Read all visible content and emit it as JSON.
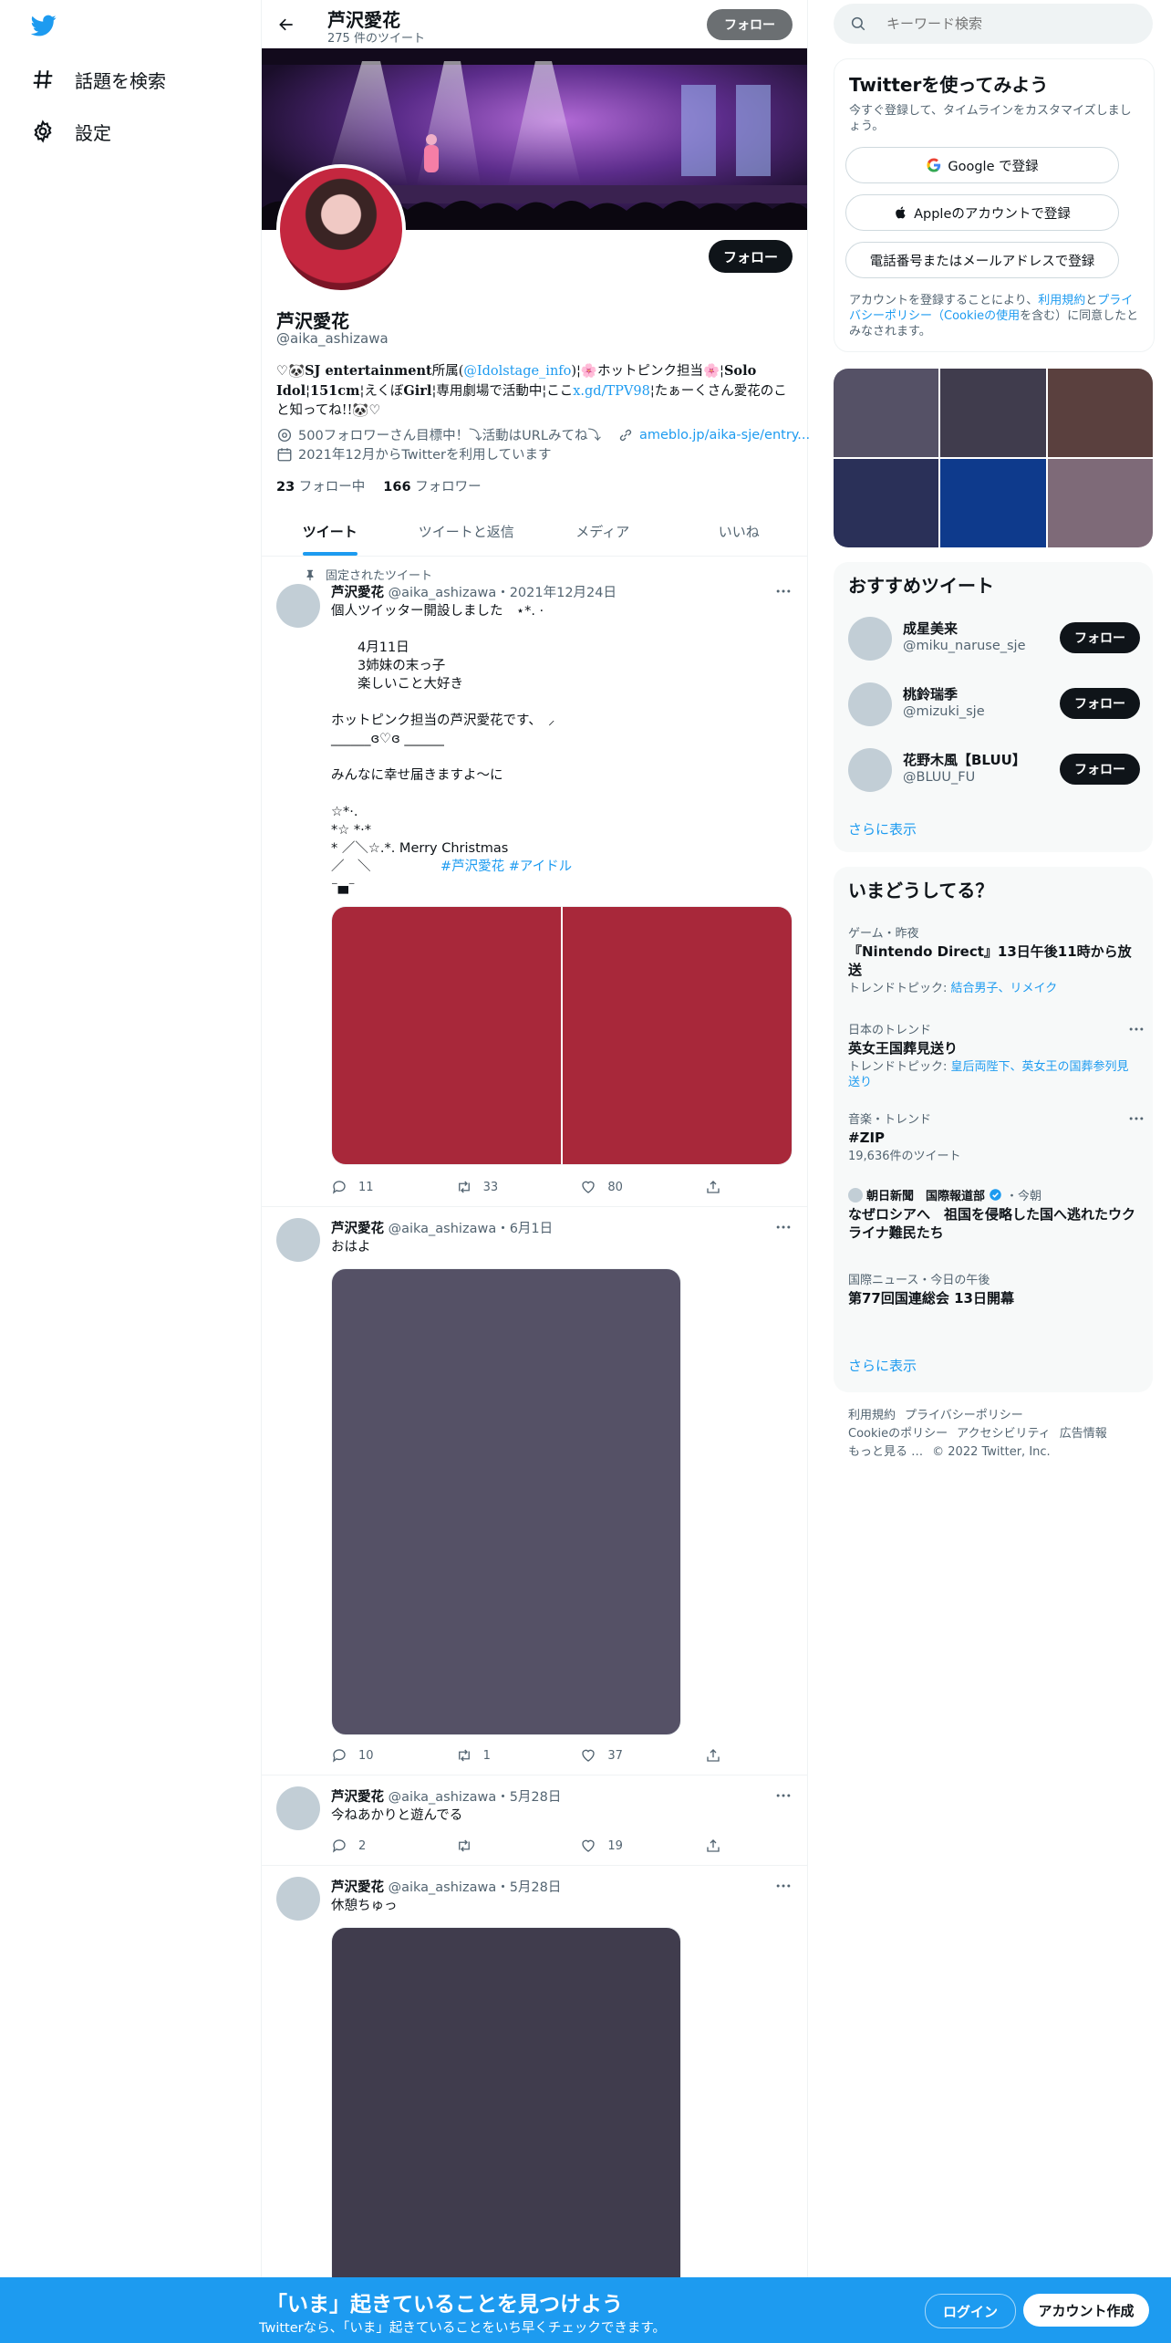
{
  "nav": {
    "explore": "話題を検索",
    "settings": "設定"
  },
  "header": {
    "name": "芦沢愛花",
    "tweet_count": "275 件のツイート",
    "follow": "フォロー"
  },
  "profile": {
    "name": "芦沢愛花",
    "handle": "@aika_ashizawa",
    "follow": "フォロー",
    "bio_parts": {
      "p1": "♡🐼",
      "p2": "SJ entertainment",
      "p3": "所属(",
      "mention": "@Idolstage_info",
      "p4": ")¦🌸ホットピンク担当🌸¦",
      "p5": "Solo Idol",
      "p6": "¦",
      "p7": "151cm",
      "p8": "¦えくぼ",
      "p9": "Girl",
      "p10": "¦専用劇場で活動中¦ここ",
      "link": "x.gd/TPV98",
      "p11": "¦たぁーくさん愛花のこと知ってね!!🐼♡"
    },
    "location": "500フォロワーさん目標中！⤵︎活動はURLみてね⤵︎",
    "url": "ameblo.jp/aika-sje/entry...",
    "joined": "2021年12月からTwitterを利用しています",
    "following_count": "23",
    "following_label": "フォロー中",
    "followers_count": "166",
    "followers_label": "フォロワー"
  },
  "tabs": [
    "ツイート",
    "ツイートと返信",
    "メディア",
    "いいね"
  ],
  "tweets": [
    {
      "pinned_label": "固定されたツイート",
      "name": "芦沢愛花",
      "handle": "@aika_ashizawa",
      "date": "・2021年12月24日",
      "text": "個人ツイッター開設しました　⋆*. ·\n\n　　4月11日\n　　3姉妹の末っ子\n　　楽しいこと大好き\n\nホットピンク担当の芦沢愛花です、　⸝\n______ɞ♡ɞ ______\n\nみんなに幸せ届きますよ〜に\n\n☆*·.\n*☆ *·*\n* ／＼☆.*. Merry Christmas\n／　＼",
      "tags": "#芦沢愛花 #アイドル",
      "replies": "11",
      "retweets": "33",
      "likes": "80"
    },
    {
      "name": "芦沢愛花",
      "handle": "@aika_ashizawa",
      "date": "・6月1日",
      "text": "おはよ",
      "replies": "10",
      "retweets": "1",
      "likes": "37"
    },
    {
      "name": "芦沢愛花",
      "handle": "@aika_ashizawa",
      "date": "・5月28日",
      "text": "今ねあかりと遊んでる",
      "replies": "2",
      "retweets": "",
      "likes": "19"
    },
    {
      "name": "芦沢愛花",
      "handle": "@aika_ashizawa",
      "date": "・5月28日",
      "text": "休憩ちゅっ"
    }
  ],
  "search": {
    "placeholder": "キーワード検索"
  },
  "signup": {
    "title": "Twitterを使ってみよう",
    "subtitle": "今すぐ登録して、タイムラインをカスタマイズしましょう。",
    "google": "Google で登録",
    "apple": "Appleのアカウントで登録",
    "phone": "電話番号またはメールアドレスで登録",
    "legal_1": "アカウントを登録することにより、",
    "legal_terms": "利用規約",
    "legal_2": "と",
    "legal_privacy": "プライバシーポリシー（Cookieの使用",
    "legal_3": "を含む）に同意したとみなされます。"
  },
  "who_to_follow": {
    "title": "おすすめツイート",
    "users": [
      {
        "name": "成星美来",
        "handle": "@miku_naruse_sje"
      },
      {
        "name": "桃鈴瑞季",
        "handle": "@mizuki_sje"
      },
      {
        "name": "花野木風【BLUU】",
        "handle": "@BLUU_FU"
      }
    ],
    "follow": "フォロー",
    "show_more": "さらに表示"
  },
  "trends": {
    "title": "いまどうしてる？",
    "items": [
      {
        "context": "ゲーム・昨夜",
        "title": "『Nintendo Direct』13日午後11時から放送",
        "sub_label": "トレンドトピック: ",
        "sub_links": "結合男子、リメイク"
      },
      {
        "context": "日本のトレンド",
        "title": "英女王国葬見送り",
        "sub_label": "トレンドトピック: ",
        "sub_links": "皇后両陛下、英女王の国葬参列見送り"
      },
      {
        "context": "音楽・トレンド",
        "title": "#ZIP",
        "sub": "19,636件のツイート"
      },
      {
        "context_source": "朝日新聞　国際報道部",
        "context_time": "・今朝",
        "title": "なぜロシアへ　祖国を侵略した国へ逃れたウクライナ難民たち"
      },
      {
        "context": "国際ニュース・今日の午後",
        "title": "第77回国連総会 13日開幕"
      }
    ],
    "show_more": "さらに表示"
  },
  "footer": {
    "terms": "利用規約",
    "privacy": "プライバシーポリシー",
    "cookie": "Cookieのポリシー",
    "accessibility": "アクセシビリティ",
    "ads": "広告情報",
    "more": "もっと見る …",
    "copyright": "© 2022 Twitter, Inc."
  },
  "bottom_bar": {
    "title": "「いま」起きていることを見つけよう",
    "subtitle": "Twitterなら、「いま」起きていることをいち早くチェックできます。",
    "login": "ログイン",
    "signup": "アカウント作成"
  },
  "colors": {
    "accent": "#1d9bf0",
    "text": "#0f1419",
    "muted": "#536471",
    "media_red": "#a8283a",
    "media_purple": "#555166",
    "media_dark": "#403c4d"
  },
  "icons": {
    "logo": "twitter-bird-icon",
    "explore": "hashtag-icon",
    "settings": "gear-icon",
    "back": "arrow-left-icon",
    "pin": "pin-icon",
    "reply": "reply-icon",
    "retweet": "retweet-icon",
    "like": "heart-icon",
    "share": "share-icon"
  }
}
